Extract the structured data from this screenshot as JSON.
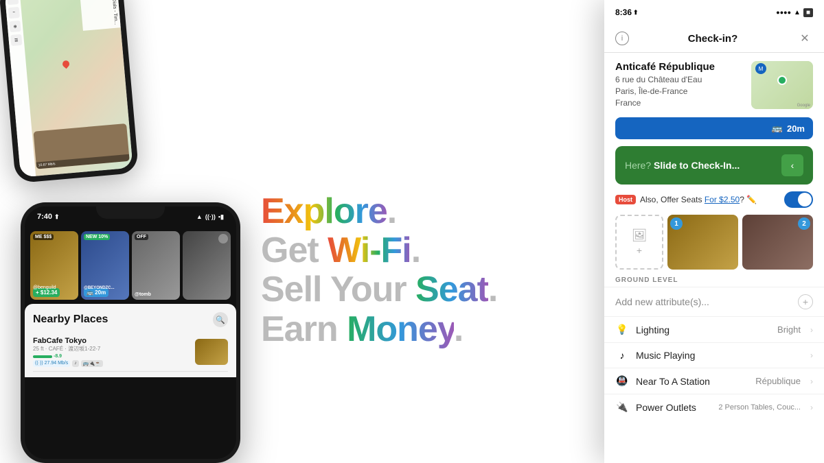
{
  "phones": {
    "top_left": {
      "map": {
        "sidebar_items": [
          "◉",
          "⊕",
          "⊙",
          "☰"
        ],
        "speed": "10.67 Mb/s",
        "caption": "Seven Dials - Tim..."
      }
    },
    "bottom_left": {
      "status_bar": {
        "time": "7:40",
        "signal": "●●●",
        "wifi": "▲",
        "battery": "■"
      },
      "stories": [
        {
          "badge": "ME $$$",
          "price": "+ $12.34",
          "user": "@benguild"
        },
        {
          "badge": "NEW 10%",
          "distance": "20m",
          "user": "@BEYONDZC..."
        },
        {
          "badge": "OFF",
          "user": "@tomb"
        },
        {
          "badge": "",
          "user": ""
        }
      ],
      "nearby": {
        "title": "Nearby Places",
        "items": [
          {
            "name": "FabCafe Tokyo",
            "distance": "25 ft",
            "type": "CAFÉ",
            "address": "渡辺坂1-22-7",
            "wifi": "27.94 Mb/s",
            "rating": "-8.9",
            "tags": [
              "wifi",
              "music",
              "icons"
            ]
          }
        ]
      }
    },
    "right": {
      "status_bar": {
        "time": "8:36",
        "signal": "●●●●",
        "wifi": "▲",
        "battery": "■"
      },
      "checkin": {
        "title": "Check-in?",
        "venue_name": "Anticafé République",
        "address_line1": "6 rue du Château d'Eau",
        "address_line2": "Paris, Île-de-France",
        "address_line3": "France",
        "distance": "20m",
        "slide_prompt": "Here?",
        "slide_action": "Slide to Check-In...",
        "host_offer": "Also, Offer Seats",
        "host_price": "For $2.50",
        "host_badge": "Host",
        "attributes_label": "GROUND LEVEL",
        "add_attr_text": "Add new attribute(s)...",
        "attributes": [
          {
            "icon": "💡",
            "name": "Lighting",
            "value": "Bright"
          },
          {
            "icon": "♪",
            "name": "Music Playing",
            "value": ""
          },
          {
            "icon": "🚇",
            "name": "Near To A Station",
            "value": "République"
          },
          {
            "icon": "🔌",
            "name": "Power Outlets",
            "value": "2 Person Tables, Couc..."
          }
        ]
      }
    }
  },
  "taglines": [
    {
      "text": "Explore.",
      "plain": "Explore",
      "punct": "."
    },
    {
      "text": "Get Wi-Fi.",
      "plain1": "Get ",
      "highlight": "Wi-Fi",
      "punct": "."
    },
    {
      "text": "Sell Your Seat.",
      "plain1": "Sell Your ",
      "highlight": "Seat",
      "punct": "."
    },
    {
      "text": "Earn Money.",
      "plain1": "Earn ",
      "highlight": "Money",
      "punct": "."
    }
  ]
}
